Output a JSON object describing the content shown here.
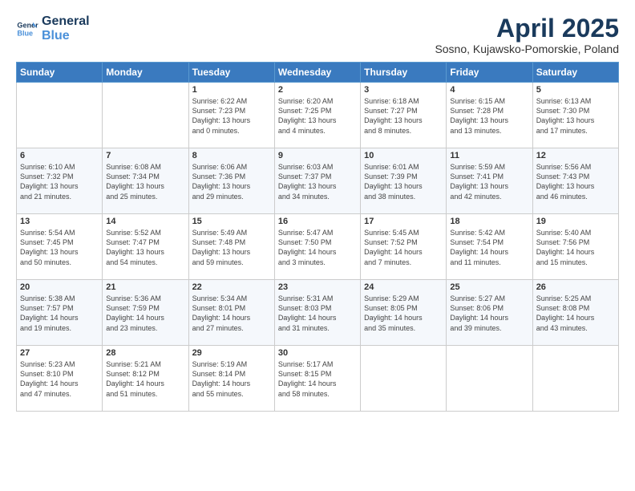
{
  "logo": {
    "line1": "General",
    "line2": "Blue"
  },
  "title": "April 2025",
  "subtitle": "Sosno, Kujawsko-Pomorskie, Poland",
  "weekdays": [
    "Sunday",
    "Monday",
    "Tuesday",
    "Wednesday",
    "Thursday",
    "Friday",
    "Saturday"
  ],
  "weeks": [
    [
      {
        "day": "",
        "info": ""
      },
      {
        "day": "",
        "info": ""
      },
      {
        "day": "1",
        "info": "Sunrise: 6:22 AM\nSunset: 7:23 PM\nDaylight: 13 hours\nand 0 minutes."
      },
      {
        "day": "2",
        "info": "Sunrise: 6:20 AM\nSunset: 7:25 PM\nDaylight: 13 hours\nand 4 minutes."
      },
      {
        "day": "3",
        "info": "Sunrise: 6:18 AM\nSunset: 7:27 PM\nDaylight: 13 hours\nand 8 minutes."
      },
      {
        "day": "4",
        "info": "Sunrise: 6:15 AM\nSunset: 7:28 PM\nDaylight: 13 hours\nand 13 minutes."
      },
      {
        "day": "5",
        "info": "Sunrise: 6:13 AM\nSunset: 7:30 PM\nDaylight: 13 hours\nand 17 minutes."
      }
    ],
    [
      {
        "day": "6",
        "info": "Sunrise: 6:10 AM\nSunset: 7:32 PM\nDaylight: 13 hours\nand 21 minutes."
      },
      {
        "day": "7",
        "info": "Sunrise: 6:08 AM\nSunset: 7:34 PM\nDaylight: 13 hours\nand 25 minutes."
      },
      {
        "day": "8",
        "info": "Sunrise: 6:06 AM\nSunset: 7:36 PM\nDaylight: 13 hours\nand 29 minutes."
      },
      {
        "day": "9",
        "info": "Sunrise: 6:03 AM\nSunset: 7:37 PM\nDaylight: 13 hours\nand 34 minutes."
      },
      {
        "day": "10",
        "info": "Sunrise: 6:01 AM\nSunset: 7:39 PM\nDaylight: 13 hours\nand 38 minutes."
      },
      {
        "day": "11",
        "info": "Sunrise: 5:59 AM\nSunset: 7:41 PM\nDaylight: 13 hours\nand 42 minutes."
      },
      {
        "day": "12",
        "info": "Sunrise: 5:56 AM\nSunset: 7:43 PM\nDaylight: 13 hours\nand 46 minutes."
      }
    ],
    [
      {
        "day": "13",
        "info": "Sunrise: 5:54 AM\nSunset: 7:45 PM\nDaylight: 13 hours\nand 50 minutes."
      },
      {
        "day": "14",
        "info": "Sunrise: 5:52 AM\nSunset: 7:47 PM\nDaylight: 13 hours\nand 54 minutes."
      },
      {
        "day": "15",
        "info": "Sunrise: 5:49 AM\nSunset: 7:48 PM\nDaylight: 13 hours\nand 59 minutes."
      },
      {
        "day": "16",
        "info": "Sunrise: 5:47 AM\nSunset: 7:50 PM\nDaylight: 14 hours\nand 3 minutes."
      },
      {
        "day": "17",
        "info": "Sunrise: 5:45 AM\nSunset: 7:52 PM\nDaylight: 14 hours\nand 7 minutes."
      },
      {
        "day": "18",
        "info": "Sunrise: 5:42 AM\nSunset: 7:54 PM\nDaylight: 14 hours\nand 11 minutes."
      },
      {
        "day": "19",
        "info": "Sunrise: 5:40 AM\nSunset: 7:56 PM\nDaylight: 14 hours\nand 15 minutes."
      }
    ],
    [
      {
        "day": "20",
        "info": "Sunrise: 5:38 AM\nSunset: 7:57 PM\nDaylight: 14 hours\nand 19 minutes."
      },
      {
        "day": "21",
        "info": "Sunrise: 5:36 AM\nSunset: 7:59 PM\nDaylight: 14 hours\nand 23 minutes."
      },
      {
        "day": "22",
        "info": "Sunrise: 5:34 AM\nSunset: 8:01 PM\nDaylight: 14 hours\nand 27 minutes."
      },
      {
        "day": "23",
        "info": "Sunrise: 5:31 AM\nSunset: 8:03 PM\nDaylight: 14 hours\nand 31 minutes."
      },
      {
        "day": "24",
        "info": "Sunrise: 5:29 AM\nSunset: 8:05 PM\nDaylight: 14 hours\nand 35 minutes."
      },
      {
        "day": "25",
        "info": "Sunrise: 5:27 AM\nSunset: 8:06 PM\nDaylight: 14 hours\nand 39 minutes."
      },
      {
        "day": "26",
        "info": "Sunrise: 5:25 AM\nSunset: 8:08 PM\nDaylight: 14 hours\nand 43 minutes."
      }
    ],
    [
      {
        "day": "27",
        "info": "Sunrise: 5:23 AM\nSunset: 8:10 PM\nDaylight: 14 hours\nand 47 minutes."
      },
      {
        "day": "28",
        "info": "Sunrise: 5:21 AM\nSunset: 8:12 PM\nDaylight: 14 hours\nand 51 minutes."
      },
      {
        "day": "29",
        "info": "Sunrise: 5:19 AM\nSunset: 8:14 PM\nDaylight: 14 hours\nand 55 minutes."
      },
      {
        "day": "30",
        "info": "Sunrise: 5:17 AM\nSunset: 8:15 PM\nDaylight: 14 hours\nand 58 minutes."
      },
      {
        "day": "",
        "info": ""
      },
      {
        "day": "",
        "info": ""
      },
      {
        "day": "",
        "info": ""
      }
    ]
  ]
}
